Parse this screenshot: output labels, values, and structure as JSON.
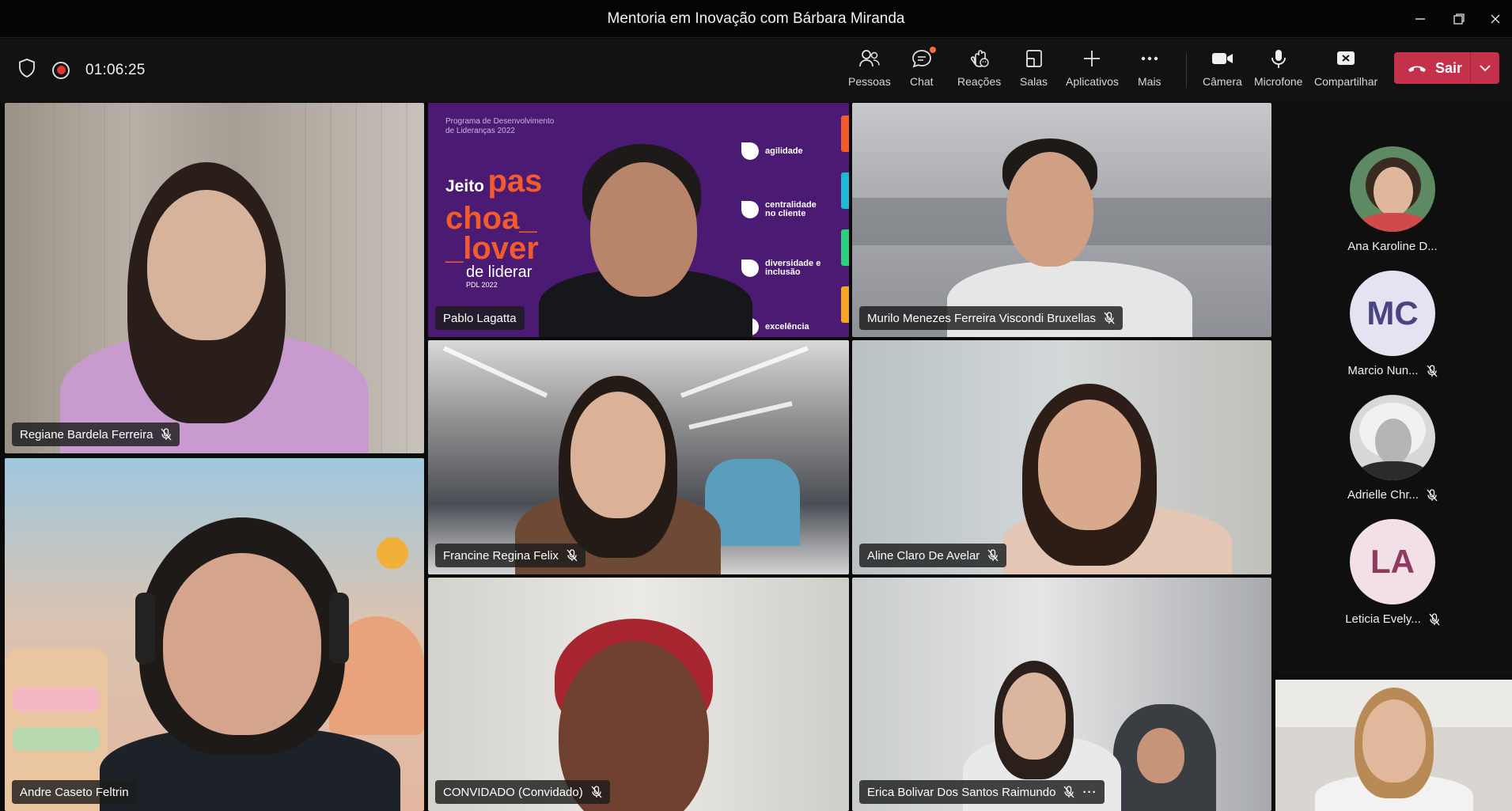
{
  "window": {
    "title": "Mentoria em Inovação com Bárbara Miranda"
  },
  "meeting": {
    "timer": "01:06:25"
  },
  "toolbar": {
    "people": "Pessoas",
    "chat": "Chat",
    "reactions": "Reações",
    "rooms": "Salas",
    "apps": "Aplicativos",
    "more": "Mais",
    "camera": "Câmera",
    "microphone": "Microfone",
    "share": "Compartilhar",
    "leave": "Sair"
  },
  "tiles": [
    {
      "name": "Regiane Bardela Ferreira",
      "muted": true
    },
    {
      "name": "Pablo Lagatta",
      "muted": false
    },
    {
      "name": "Murilo Menezes Ferreira Viscondi Bruxellas",
      "muted": true
    },
    {
      "name": "Francine Regina Felix",
      "muted": true
    },
    {
      "name": "Aline Claro De Avelar",
      "muted": true
    },
    {
      "name": "Andre Caseto Feltrin",
      "muted": false
    },
    {
      "name": "CONVIDADO (Convidado)",
      "muted": true
    },
    {
      "name": "Erica Bolivar Dos Santos Raimundo",
      "muted": true,
      "more": "···"
    }
  ],
  "background_slide": {
    "program": "Programa de Desenvolvimento de Lideranças 2022",
    "jeito": "Jeito",
    "line1": "pas",
    "line2": "choa_",
    "line3": "_lover",
    "line4": "de liderar",
    "line5": "PDL 2022",
    "values": [
      "agilidade",
      "centralidade no cliente",
      "diversidade e inclusão",
      "excelência"
    ]
  },
  "roster": [
    {
      "name": "Ana Karoline D...",
      "muted": false,
      "initials": ""
    },
    {
      "name": "Marcio Nun...",
      "muted": true,
      "initials": "MC"
    },
    {
      "name": "Adrielle Chr...",
      "muted": true,
      "initials": ""
    },
    {
      "name": "Leticia Evely...",
      "muted": true,
      "initials": "LA"
    }
  ],
  "colors": {
    "leave": "#c4314b",
    "avatar_mc_bg": "#e6e2f2",
    "avatar_mc_fg": "#4a4582",
    "avatar_la_bg": "#f3dfe6",
    "avatar_la_fg": "#8d3b5f",
    "slide_purple": "#4b1a73",
    "slide_orange": "#f25c2c"
  }
}
